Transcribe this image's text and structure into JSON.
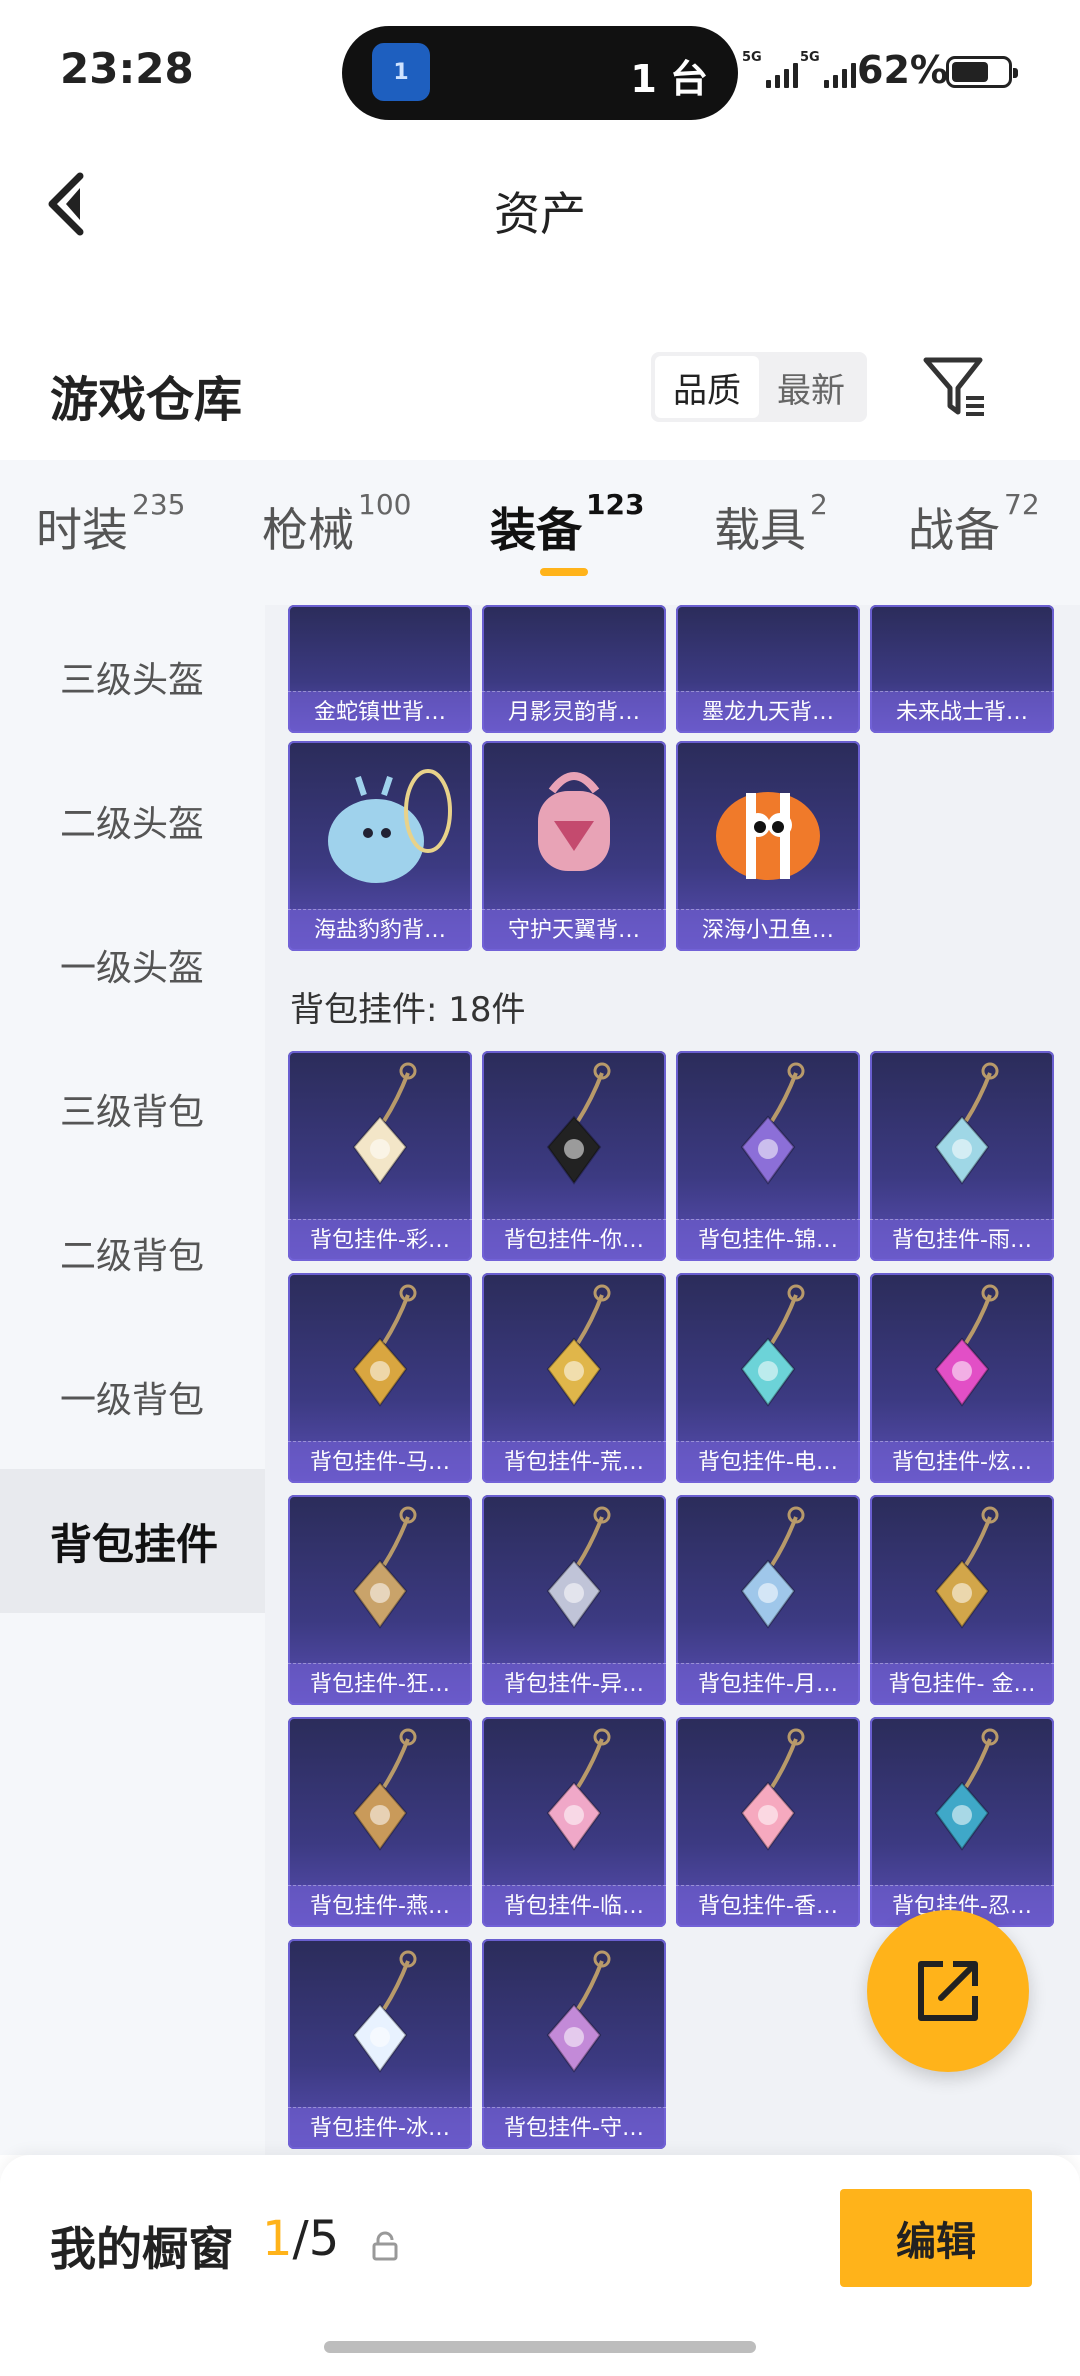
{
  "status_bar": {
    "time": "23:28",
    "island_app_badge": "1",
    "island_text": "1 台",
    "network_1": "5G",
    "network_2": "5G",
    "battery": "62%"
  },
  "header": {
    "title": "资产"
  },
  "section": {
    "title": "游戏仓库",
    "sort_options": [
      "品质",
      "最新"
    ],
    "sort_selected": "品质"
  },
  "tabs": [
    {
      "label": "时装",
      "count": "235"
    },
    {
      "label": "枪械",
      "count": "100"
    },
    {
      "label": "装备",
      "count": "123",
      "active": true
    },
    {
      "label": "载具",
      "count": "2"
    },
    {
      "label": "战备",
      "count": "72"
    }
  ],
  "sidebar": [
    {
      "label": "三级头盔"
    },
    {
      "label": "二级头盔"
    },
    {
      "label": "一级头盔"
    },
    {
      "label": "三级背包"
    },
    {
      "label": "二级背包"
    },
    {
      "label": "一级背包"
    },
    {
      "label": "背包挂件",
      "active": true
    }
  ],
  "backpacks": [
    {
      "name": "金蛇镇世背…",
      "icon": "gold-backpack"
    },
    {
      "name": "月影灵韵背…",
      "icon": "moon-backpack"
    },
    {
      "name": "墨龙九天背…",
      "icon": "dragon-backpack"
    },
    {
      "name": "未来战士背…",
      "icon": "warrior-backpack"
    },
    {
      "name": "海盐豹豹背…",
      "icon": "seal-backpack"
    },
    {
      "name": "守护天翼背…",
      "icon": "pink-wing-backpack"
    },
    {
      "name": "深海小丑鱼…",
      "icon": "clownfish-backpack"
    }
  ],
  "charm_group_label": "背包挂件: 18件",
  "charms": [
    {
      "name": "背包挂件-彩…",
      "icon": "ice-cream-charm",
      "color": "#f3e6c8"
    },
    {
      "name": "背包挂件-你…",
      "icon": "penguin-charm",
      "color": "#222222"
    },
    {
      "name": "背包挂件-锦…",
      "icon": "fan-charm",
      "color": "#8c6fd8"
    },
    {
      "name": "背包挂件-雨…",
      "icon": "sword-charm",
      "color": "#9fd7e6"
    },
    {
      "name": "背包挂件-马…",
      "icon": "horse-charm",
      "color": "#d9a640"
    },
    {
      "name": "背包挂件-荒…",
      "icon": "sun-charm",
      "color": "#e0b64a"
    },
    {
      "name": "背包挂件-电…",
      "icon": "arcade-charm",
      "color": "#6cd3d8"
    },
    {
      "name": "背包挂件-炫…",
      "icon": "candy-charm",
      "color": "#e24fc6"
    },
    {
      "name": "背包挂件-狂…",
      "icon": "claw-charm",
      "color": "#c9a36a"
    },
    {
      "name": "背包挂件-异…",
      "icon": "winged-shield-charm",
      "color": "#c0c4d8"
    },
    {
      "name": "背包挂件-月…",
      "icon": "rabbit-charm",
      "color": "#9fc7ea"
    },
    {
      "name": "背包挂件- 金…",
      "icon": "eye-charm",
      "color": "#d2a64a"
    },
    {
      "name": "背包挂件-燕…",
      "icon": "swallow-charm",
      "color": "#c99a5a"
    },
    {
      "name": "背包挂件-临…",
      "icon": "butterfly-charm",
      "color": "#f0a8c8"
    },
    {
      "name": "背包挂件-香…",
      "icon": "flower-charm",
      "color": "#f6a9bf"
    },
    {
      "name": "背包挂件-忍…",
      "icon": "shuriken-charm",
      "color": "#3fa8c8"
    },
    {
      "name": "背包挂件-冰…",
      "icon": "robot-charm",
      "color": "#e8f2ff"
    },
    {
      "name": "背包挂件-守…",
      "icon": "gem-charm",
      "color": "#c38ad8"
    }
  ],
  "bottom_bar": {
    "label": "我的橱窗",
    "current": "1",
    "total": "/5",
    "edit_label": "编辑"
  },
  "colors": {
    "accent": "#ffb31a",
    "card_bg": "#3c3a82"
  }
}
